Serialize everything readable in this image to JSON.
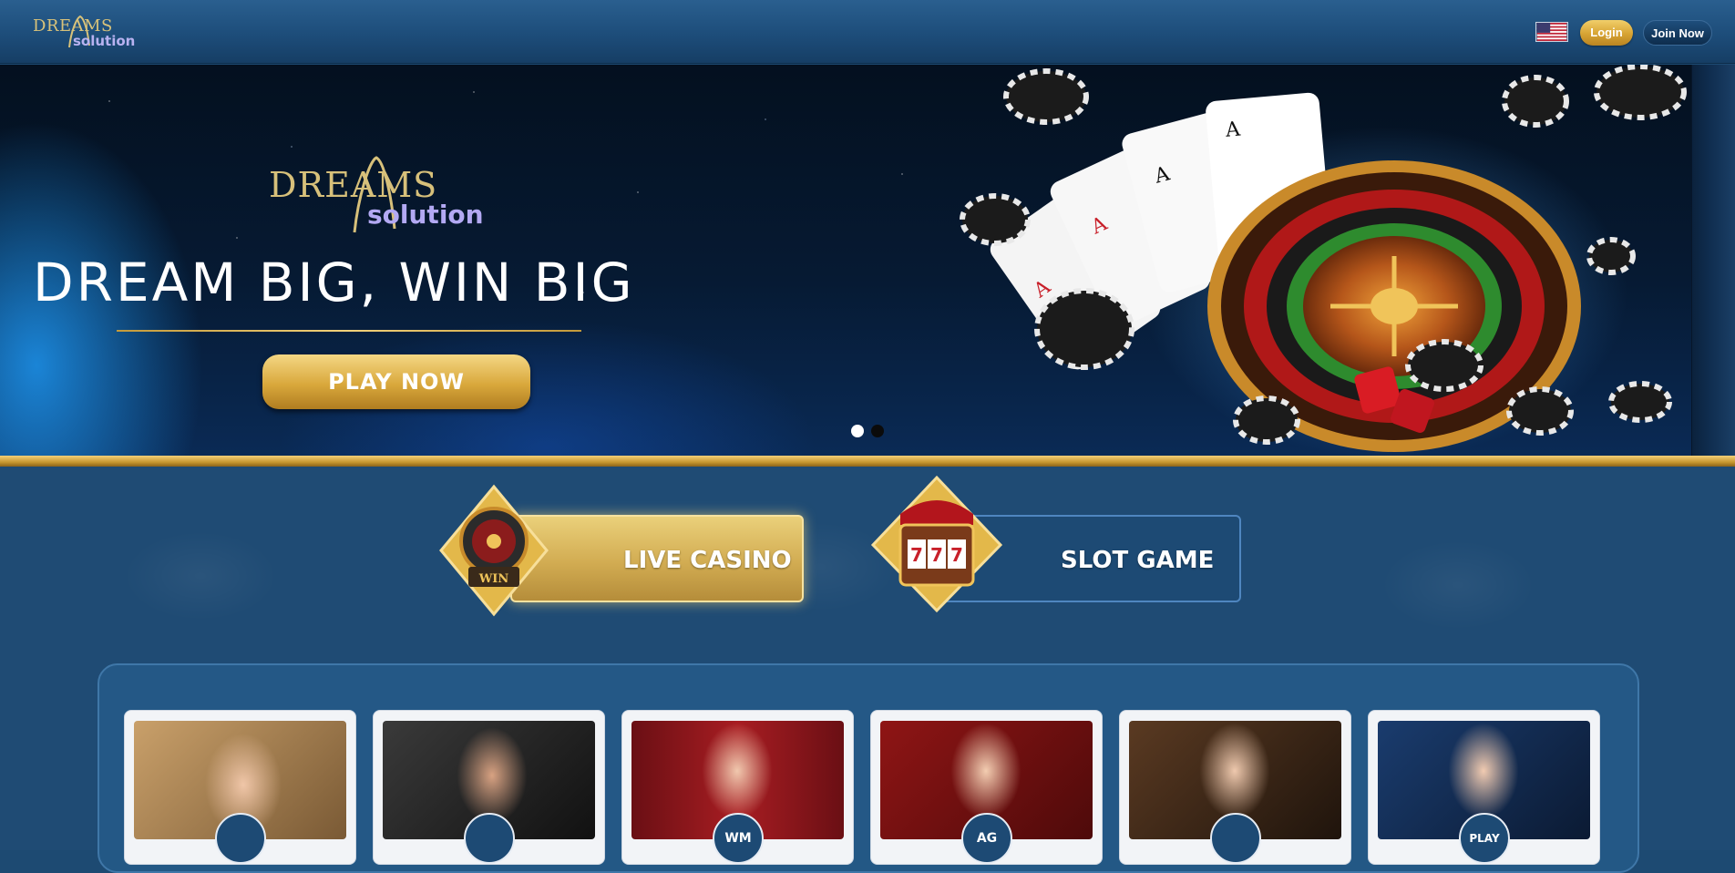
{
  "header": {
    "logo": {
      "word_top": "DREAMS",
      "word_bottom": "solution"
    },
    "flag_icon": "us-flag-icon",
    "login_label": "Login",
    "join_label": "Join Now"
  },
  "banner": {
    "logo": {
      "word_top": "DREAMS",
      "word_bottom": "solution"
    },
    "tagline": "DREAM BIG, WIN BIG",
    "play_label": "PLAY NOW",
    "slides": [
      {
        "active": true
      },
      {
        "active": false
      }
    ]
  },
  "categories": [
    {
      "label": "LIVE CASINO",
      "active": true,
      "icon": "roulette-wheel-icon"
    },
    {
      "label": "SLOT GAME",
      "active": false,
      "icon": "slot-machine-icon"
    }
  ],
  "providers": [
    {
      "icon": "provider-logo-1",
      "badge": "",
      "accent": "#c9a06a"
    },
    {
      "icon": "provider-logo-2",
      "badge": "",
      "accent": "#2c2c2c"
    },
    {
      "icon": "provider-logo-wm",
      "badge": "WM",
      "accent": "#8f1c1f"
    },
    {
      "icon": "provider-logo-ag",
      "badge": "AG",
      "accent": "#7a1414"
    },
    {
      "icon": "provider-logo-5",
      "badge": "",
      "accent": "#5a3a22"
    },
    {
      "icon": "provider-logo-play",
      "badge": "PLAY",
      "accent": "#1a3c6e"
    }
  ],
  "colors": {
    "header_bg": "#1d4d7a",
    "gold": "#d7a333",
    "main_bg": "#1f4b74"
  }
}
